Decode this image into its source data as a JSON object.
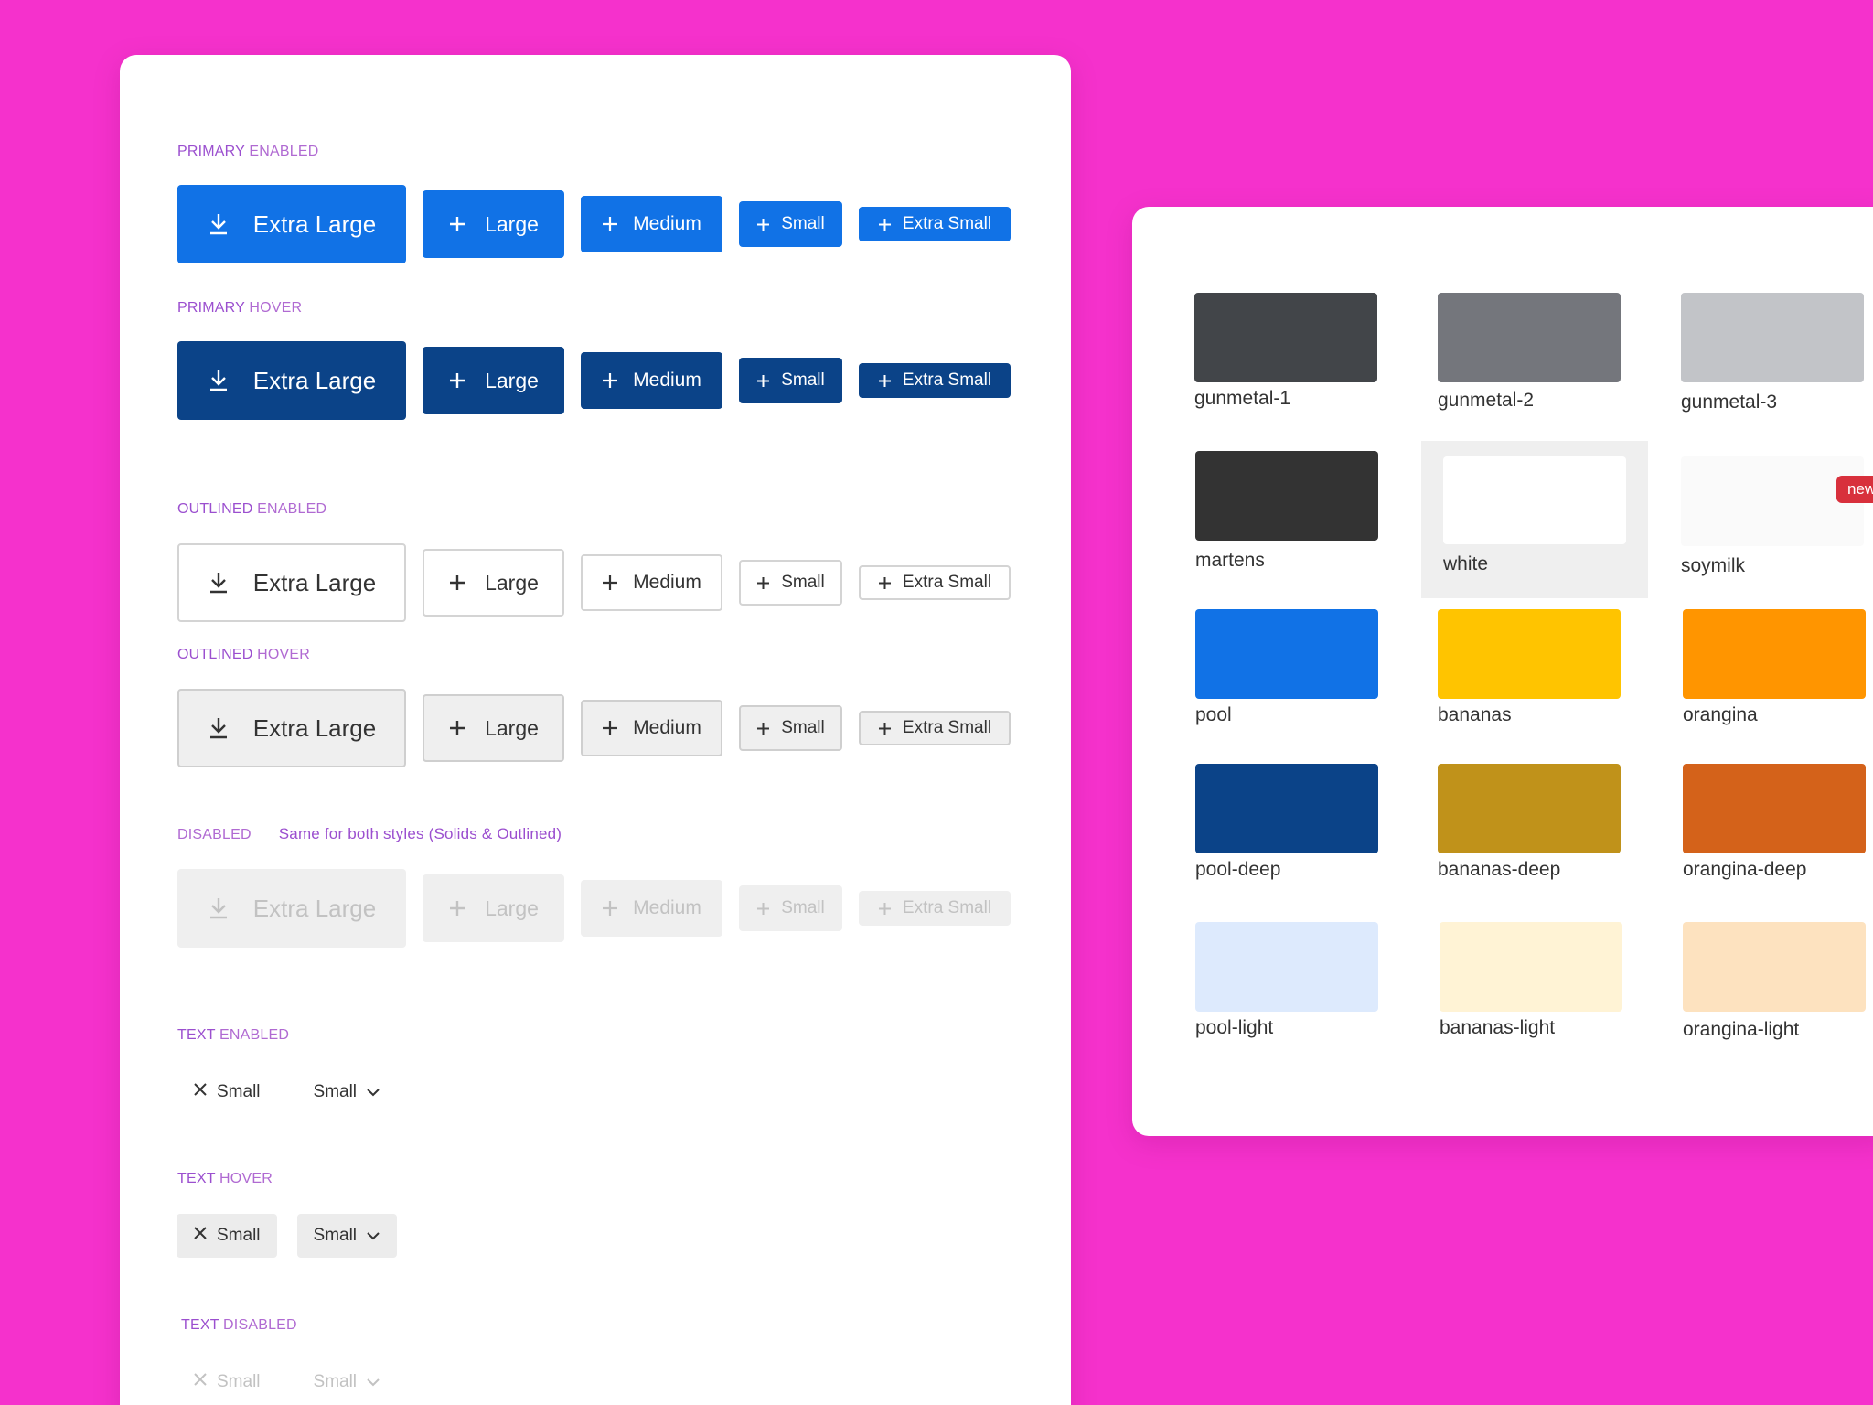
{
  "button_sizes": {
    "xl": "Extra Large",
    "lg": "Large",
    "md": "Medium",
    "sm": "Small",
    "xs": "Extra Small"
  },
  "sections": {
    "primary_enabled": {
      "strong": "PRIMARY",
      "rest": " ENABLED"
    },
    "primary_hover": {
      "strong": "PRIMARY",
      "rest": " HOVER"
    },
    "outlined_enabled": {
      "strong": "OUTLINED",
      "rest": " ENABLED"
    },
    "outlined_hover": {
      "strong": "OUTLINED",
      "rest": " HOVER"
    },
    "disabled": {
      "strong": "",
      "rest": "DISABLED",
      "note": "Same for both styles (Solids & Outlined)"
    },
    "text_enabled": {
      "strong": "TEXT",
      "rest": " ENABLED"
    },
    "text_hover": {
      "strong": "TEXT",
      "rest": " HOVER"
    },
    "text_disabled": {
      "strong": "TEXT",
      "rest": " DISABLED"
    }
  },
  "text_buttons": {
    "close_label": "Small",
    "dropdown_label": "Small"
  },
  "icons": {
    "xl": "download-icon",
    "others": "plus-icon",
    "close": "close-icon",
    "dropdown": "chevron-down-icon"
  },
  "colors": {
    "background": "#f531cc",
    "primary": "#1172e6",
    "primary_hover": "#0b4388",
    "label": "#b06ad2"
  },
  "swatches": [
    {
      "name": "gunmetal-1",
      "color": "#424549"
    },
    {
      "name": "gunmetal-2",
      "color": "#74767c"
    },
    {
      "name": "gunmetal-3",
      "color": "#c2c4c8"
    },
    {
      "name": "martens",
      "color": "#333333"
    },
    {
      "name": "white",
      "color": "#ffffff"
    },
    {
      "name": "soymilk",
      "color": "#fafafa"
    },
    {
      "name": "pool",
      "color": "#1172e6"
    },
    {
      "name": "bananas",
      "color": "#ffc400"
    },
    {
      "name": "orangina",
      "color": "#ff9500"
    },
    {
      "name": "pool-deep",
      "color": "#0b4388"
    },
    {
      "name": "bananas-deep",
      "color": "#c0921a"
    },
    {
      "name": "orangina-deep",
      "color": "#d4621a"
    },
    {
      "name": "pool-light",
      "color": "#ddeafd"
    },
    {
      "name": "bananas-light",
      "color": "#fff3d5"
    },
    {
      "name": "orangina-light",
      "color": "#fde2bf"
    }
  ],
  "badge": "new"
}
